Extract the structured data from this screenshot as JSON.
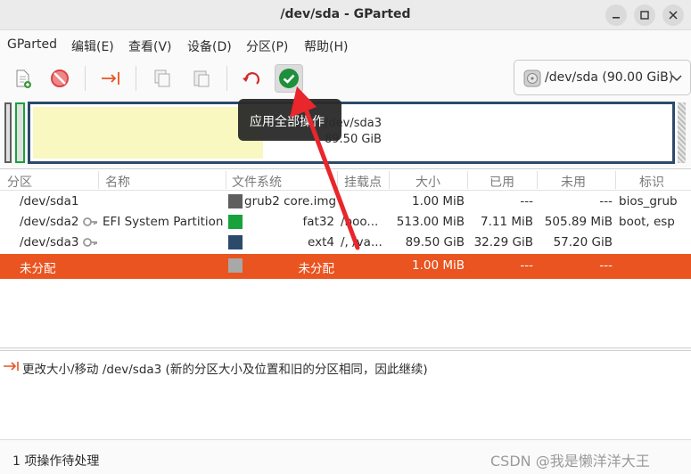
{
  "window": {
    "title": "/dev/sda - GParted"
  },
  "menu": [
    {
      "label": "GParted"
    },
    {
      "label": "编辑(E)"
    },
    {
      "label": "查看(V)"
    },
    {
      "label": "设备(D)"
    },
    {
      "label": "分区(P)"
    },
    {
      "label": "帮助(H)"
    }
  ],
  "toolbar": {
    "device_selector": "/dev/sda (90.00 GiB)",
    "tooltip": "应用全部操作"
  },
  "disk_graphic": {
    "partition_name": "/dev/sda3",
    "partition_size": "89.50 GiB"
  },
  "table": {
    "headers": [
      "分区",
      "名称",
      "文件系统",
      "挂载点",
      "大小",
      "已用",
      "未用",
      "标识"
    ],
    "rows": [
      {
        "partition": "/dev/sda1",
        "name": "",
        "fs": "grub2 core.img",
        "mount": "",
        "size": "1.00 MiB",
        "used": "---",
        "unused": "---",
        "flags": "bios_grub",
        "color": "#5e5e5e",
        "locked": false
      },
      {
        "partition": "/dev/sda2",
        "name": "EFI System Partition",
        "fs": "fat32",
        "mount": "/boo...",
        "size": "513.00 MiB",
        "used": "7.11 MiB",
        "unused": "505.89 MiB",
        "flags": "boot, esp",
        "color": "#18a23c",
        "locked": true
      },
      {
        "partition": "/dev/sda3",
        "name": "",
        "fs": "ext4",
        "mount": "/, /va...",
        "size": "89.50 GiB",
        "used": "32.29 GiB",
        "unused": "57.20 GiB",
        "flags": "",
        "color": "#2c4a6a",
        "locked": true
      },
      {
        "partition": "未分配",
        "name": "",
        "fs": "未分配",
        "mount": "",
        "size": "1.00 MiB",
        "used": "---",
        "unused": "---",
        "flags": "",
        "color": "#a8a8a8",
        "locked": false
      }
    ]
  },
  "operations": [
    {
      "text": "更改大小/移动 /dev/sda3 (新的分区大小及位置和旧的分区相同，因此继续)"
    }
  ],
  "status": {
    "pending": "1 项操作待处理"
  },
  "watermark": "CSDN @我是懒洋洋大王",
  "colors": {
    "accent": "#e95420",
    "apply_green": "#1e8f3a",
    "arrow_red": "#e8262b"
  }
}
